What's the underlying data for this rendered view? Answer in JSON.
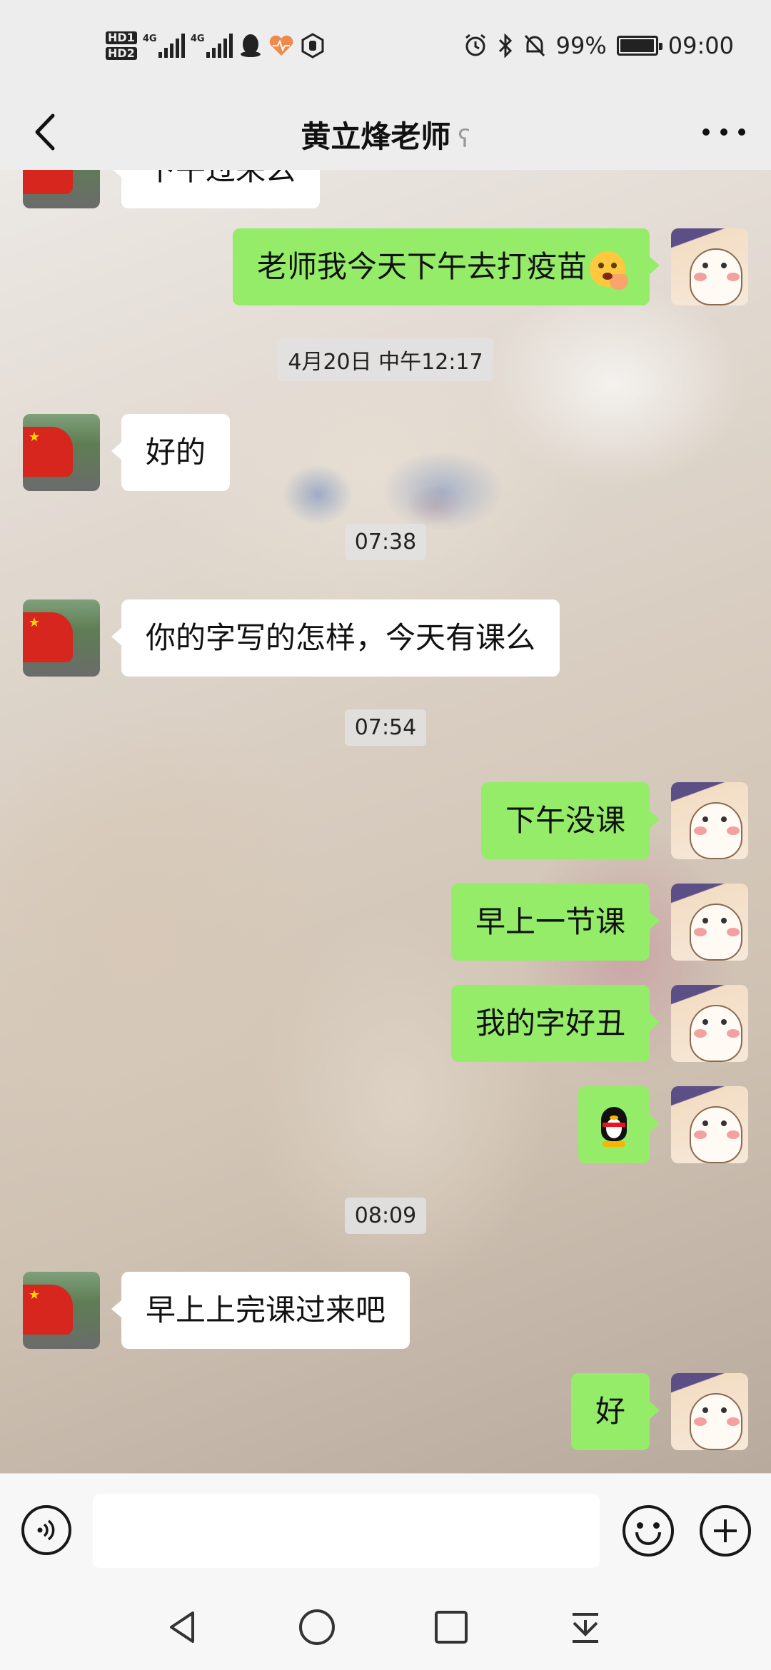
{
  "status_bar": {
    "hd_labels": [
      "HD1",
      "HD2"
    ],
    "network_labels": [
      "4G",
      "4G"
    ],
    "battery_percent": "99%",
    "battery_level": 0.99,
    "time": "09:00",
    "icons": [
      "qq-penguin-icon",
      "health-heart-icon",
      "hexagon-hand-icon",
      "alarm-icon",
      "bluetooth-icon",
      "mute-bell-icon"
    ]
  },
  "header": {
    "title": "黄立烽老师",
    "ear_icon": "ear-icon",
    "back_icon": "chevron-left-icon",
    "more_icon": "more-dots-icon"
  },
  "messages": [
    {
      "type": "in",
      "text": "下午过来么",
      "partial": true
    },
    {
      "type": "out",
      "text": "老师我今天下午去打疫苗",
      "emoji": "hand-over-mouth-emoji"
    },
    {
      "type": "time",
      "text": "4月20日 中午12:17"
    },
    {
      "type": "in",
      "text": "好的"
    },
    {
      "type": "time",
      "text": "07:38"
    },
    {
      "type": "in",
      "text": "你的字写的怎样，今天有课么"
    },
    {
      "type": "time",
      "text": "07:54"
    },
    {
      "type": "out",
      "text": "下午没课"
    },
    {
      "type": "out",
      "text": "早上一节课"
    },
    {
      "type": "out",
      "text": "我的字好丑"
    },
    {
      "type": "out",
      "text": "",
      "emoji": "qq-penguin-sticker"
    },
    {
      "type": "time",
      "text": "08:09"
    },
    {
      "type": "in",
      "text": "早上上完课过来吧"
    },
    {
      "type": "out",
      "text": "好"
    }
  ],
  "input_bar": {
    "value": "",
    "voice_icon": "voice-icon",
    "emoji_icon": "smiley-icon",
    "plus_icon": "plus-circle-icon"
  },
  "nav_bar": {
    "icons": [
      "back-triangle-icon",
      "home-circle-icon",
      "recents-square-icon",
      "notification-pull-icon"
    ]
  },
  "colors": {
    "outgoing_bubble": "#95ec69",
    "incoming_bubble": "#ffffff",
    "bar_background": "#ededed"
  }
}
